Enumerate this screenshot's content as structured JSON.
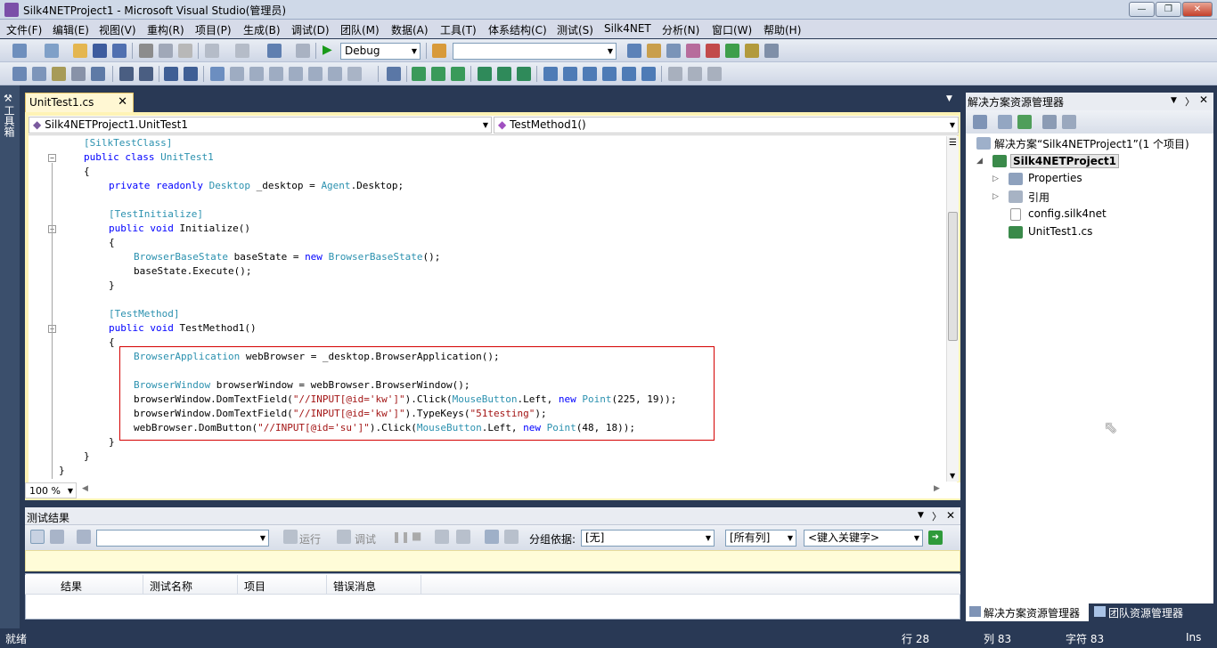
{
  "window": {
    "title": "Silk4NETProject1 - Microsoft Visual Studio(管理员)"
  },
  "menu": [
    "文件(F)",
    "编辑(E)",
    "视图(V)",
    "重构(R)",
    "项目(P)",
    "生成(B)",
    "调试(D)",
    "团队(M)",
    "数据(A)",
    "工具(T)",
    "体系结构(C)",
    "测试(S)",
    "Silk4NET",
    "分析(N)",
    "窗口(W)",
    "帮助(H)"
  ],
  "toolbar": {
    "config": "Debug",
    "platform": ""
  },
  "toolbox": {
    "label": "工具箱"
  },
  "editor": {
    "tab": "UnitTest1.cs",
    "nav_class": "Silk4NETProject1.UnitTest1",
    "nav_member": "TestMethod1()",
    "zoom": "100 %",
    "lines": [
      [
        [
          "t",
          "[SilkTestClass]"
        ]
      ],
      [
        [
          "k",
          "public class "
        ],
        [
          "t",
          "UnitTest1"
        ]
      ],
      [
        [
          "p",
          "{"
        ]
      ],
      [
        [
          "k",
          "private readonly "
        ],
        [
          "t",
          "Desktop"
        ],
        [
          "p",
          " _desktop = "
        ],
        [
          "t",
          "Agent"
        ],
        [
          "p",
          ".Desktop;"
        ]
      ],
      [],
      [
        [
          "t",
          "[TestInitialize]"
        ]
      ],
      [
        [
          "k",
          "public void "
        ],
        [
          "p",
          "Initialize()"
        ]
      ],
      [
        [
          "p",
          "{"
        ]
      ],
      [
        [
          "t",
          "BrowserBaseState"
        ],
        [
          "p",
          " baseState = "
        ],
        [
          "k",
          "new "
        ],
        [
          "t",
          "BrowserBaseState"
        ],
        [
          "p",
          "();"
        ]
      ],
      [
        [
          "p",
          "baseState.Execute();"
        ]
      ],
      [
        [
          "p",
          "}"
        ]
      ],
      [],
      [
        [
          "t",
          "[TestMethod]"
        ]
      ],
      [
        [
          "k",
          "public void "
        ],
        [
          "p",
          "TestMethod1()"
        ]
      ],
      [
        [
          "p",
          "{"
        ]
      ],
      [
        [
          "t",
          "BrowserApplication"
        ],
        [
          "p",
          " webBrowser = _desktop.BrowserApplication();"
        ]
      ],
      [],
      [
        [
          "t",
          "BrowserWindow"
        ],
        [
          "p",
          " browserWindow = webBrowser.BrowserWindow();"
        ]
      ],
      [
        [
          "p",
          "browserWindow.DomTextField("
        ],
        [
          "s",
          "\"//INPUT[@id='kw']\""
        ],
        [
          "p",
          ").Click("
        ],
        [
          "t",
          "MouseButton"
        ],
        [
          "p",
          ".Left, "
        ],
        [
          "k",
          "new "
        ],
        [
          "t",
          "Point"
        ],
        [
          "p",
          "(225, 19));"
        ]
      ],
      [
        [
          "p",
          "browserWindow.DomTextField("
        ],
        [
          "s",
          "\"//INPUT[@id='kw']\""
        ],
        [
          "p",
          ").TypeKeys("
        ],
        [
          "s",
          "\"51testing\""
        ],
        [
          "p",
          ");"
        ]
      ],
      [
        [
          "p",
          "webBrowser.DomButton("
        ],
        [
          "s",
          "\"//INPUT[@id='su']\""
        ],
        [
          "p",
          ").Click("
        ],
        [
          "t",
          "MouseButton"
        ],
        [
          "p",
          ".Left, "
        ],
        [
          "k",
          "new "
        ],
        [
          "t",
          "Point"
        ],
        [
          "p",
          "(48, 18));"
        ]
      ],
      [
        [
          "p",
          "}"
        ]
      ],
      [
        [
          "p",
          "}"
        ]
      ],
      [
        [
          "p",
          "}"
        ]
      ]
    ]
  },
  "test_results": {
    "title": "测试结果",
    "run": "运行",
    "debug": "调试",
    "group_by_label": "分组依据:",
    "group_by_value": "[无]",
    "columns_value": "[所有列]",
    "keyword_placeholder": "<键入关键字>",
    "headers": [
      "结果",
      "测试名称",
      "项目",
      "错误消息"
    ]
  },
  "solution_explorer": {
    "title": "解决方案资源管理器",
    "solution": "解决方案“Silk4NETProject1”(1 个项目)",
    "project": "Silk4NETProject1",
    "items": [
      "Properties",
      "引用",
      "config.silk4net",
      "UnitTest1.cs"
    ],
    "tab_solution": "解决方案资源管理器",
    "tab_team": "团队资源管理器"
  },
  "status": {
    "ready": "就绪",
    "line": "行 28",
    "col": "列 83",
    "char": "字符 83",
    "mode": "Ins"
  }
}
